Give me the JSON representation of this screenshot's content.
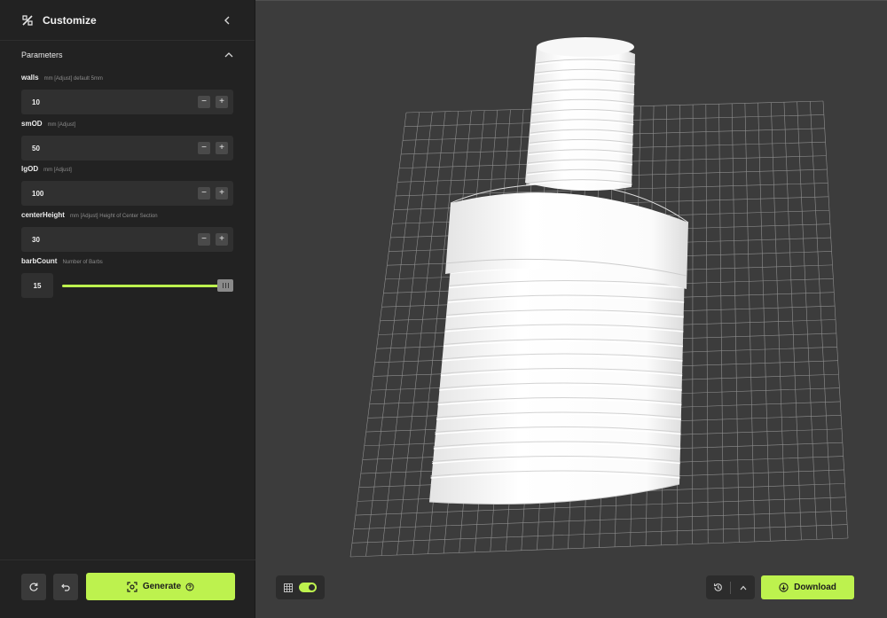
{
  "sidebar": {
    "title": "Customize",
    "section_title": "Parameters",
    "params": [
      {
        "name": "walls",
        "hint": "mm [Adjust] default 5mm",
        "value": "10"
      },
      {
        "name": "smOD",
        "hint": "mm [Adjust]",
        "value": "50"
      },
      {
        "name": "lgOD",
        "hint": "mm [Adjust]",
        "value": "100"
      },
      {
        "name": "centerHeight",
        "hint": "mm [Adjust] Height of Center Section",
        "value": "30"
      }
    ],
    "slider": {
      "name": "barbCount",
      "hint": "Number of Barbs",
      "value": "15",
      "fill_fraction": 1.0
    },
    "step_minus": "−",
    "step_plus": "+"
  },
  "footer": {
    "generate_label": "Generate"
  },
  "viewport": {
    "grid_toggle_on": true,
    "download_label": "Download",
    "accent_color": "#bdf24e"
  }
}
